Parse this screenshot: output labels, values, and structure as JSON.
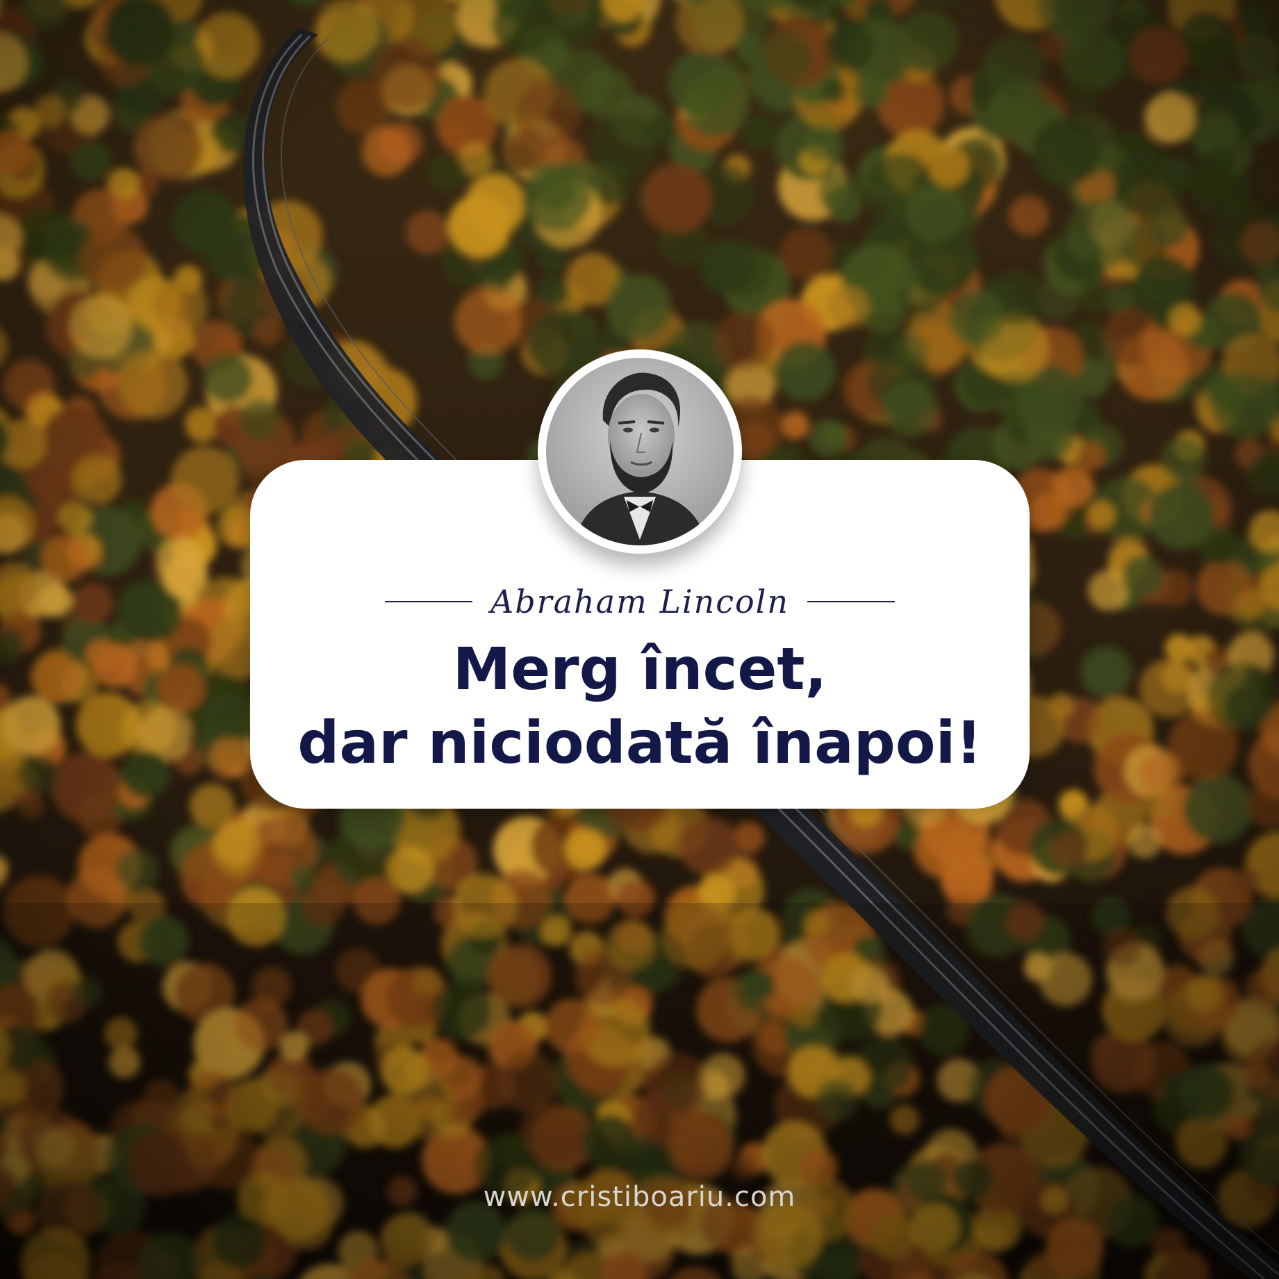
{
  "quote_card": {
    "author": "Abraham Lincoln",
    "lines": [
      "Merg încet,",
      "dar niciodată înapoi!"
    ]
  },
  "footer": {
    "website": "www.cristiboariu.com"
  },
  "colors": {
    "text_navy": "#141848",
    "card": "#ffffff",
    "foliage_orange": "#b8651c",
    "foliage_gold": "#c9921e",
    "foliage_green": "#2f3a14"
  },
  "icons": {
    "portrait": "abraham-lincoln-portrait-photo",
    "background": "autumn-forest-railway-aerial-photo"
  }
}
